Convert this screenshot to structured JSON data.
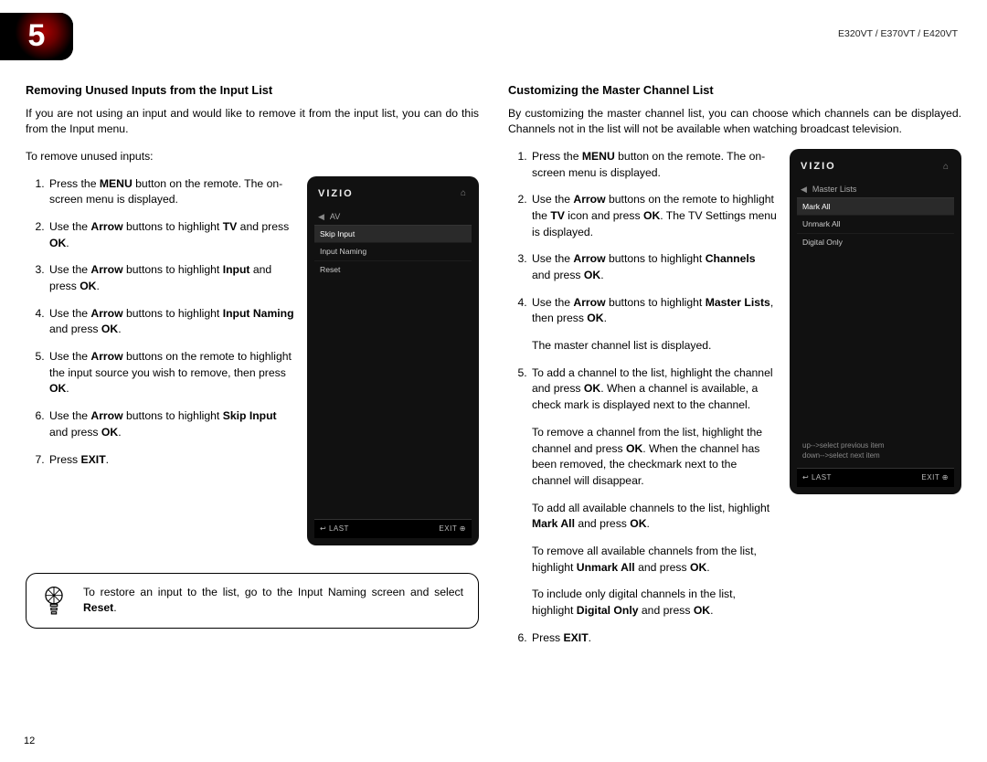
{
  "chapter_number": "5",
  "model_string": "E320VT / E370VT / E420VT",
  "page_number": "12",
  "left": {
    "heading": "Removing Unused Inputs from the Input List",
    "intro": "If you are not using an input and would like to remove it from the input list, you can do this from the Input menu.",
    "lead": "To remove unused inputs:",
    "steps": [
      {
        "parts": [
          "Press the ",
          "MENU",
          " button on the remote. The on-screen menu is displayed."
        ]
      },
      {
        "parts": [
          "Use the ",
          "Arrow",
          " buttons to highlight ",
          "TV",
          " and press ",
          "OK",
          "."
        ]
      },
      {
        "parts": [
          "Use the ",
          "Arrow",
          " buttons to highlight ",
          "Input",
          " and press ",
          "OK",
          "."
        ]
      },
      {
        "parts": [
          "Use the ",
          "Arrow",
          " buttons to highlight ",
          "Input Naming",
          " and press ",
          "OK",
          "."
        ]
      },
      {
        "parts": [
          "Use the ",
          "Arrow",
          " buttons on the remote to highlight the input source you wish to remove, then press ",
          "OK",
          "."
        ]
      },
      {
        "parts": [
          "Use the ",
          "Arrow",
          " buttons to highlight ",
          "Skip Input",
          " and press ",
          "OK",
          "."
        ]
      },
      {
        "parts": [
          "Press ",
          "EXIT",
          "."
        ]
      }
    ],
    "phone": {
      "brand": "VIZIO",
      "crumb": "AV",
      "rows": [
        "Skip Input",
        "Input Naming",
        "Reset"
      ],
      "last": "LAST",
      "exit": "EXIT"
    },
    "tip_pre": "To restore an input to the list, go to the Input Naming screen and select ",
    "tip_bold": "Reset",
    "tip_post": "."
  },
  "right": {
    "heading": "Customizing the Master Channel List",
    "intro": "By customizing the master channel list, you can choose which channels can be displayed. Channels not in the list will not be available when watching broadcast television.",
    "steps": [
      {
        "parts": [
          "Press the ",
          "MENU",
          " button on the remote. The on-screen menu is displayed."
        ]
      },
      {
        "parts": [
          "Use the ",
          "Arrow",
          " buttons on the remote to highlight the ",
          "TV",
          " icon and press ",
          "OK",
          ". The TV Settings menu is displayed."
        ]
      },
      {
        "parts": [
          "Use the ",
          "Arrow",
          " buttons to highlight ",
          "Channels",
          " and press ",
          "OK",
          "."
        ]
      },
      {
        "parts": [
          "Use the ",
          "Arrow",
          " buttons to highlight ",
          "Master Lists",
          ", then press ",
          "OK",
          "."
        ],
        "extra": "The master channel list is displayed."
      },
      {
        "parts": [
          "To add a channel to the list, highlight the channel and press ",
          "OK",
          ". When a channel is available, a check mark is displayed next to the channel."
        ],
        "extra_rich": [
          {
            "plain": [
              "To remove a channel from the list, highlight the channel and press ",
              "OK",
              ". When the channel has been removed, the checkmark next to the channel will disappear."
            ]
          },
          {
            "plain": [
              "To add all available channels to the list, highlight ",
              "Mark All",
              " and press ",
              "OK",
              "."
            ]
          },
          {
            "plain": [
              "To remove all available channels from the list, highlight ",
              "Unmark All",
              " and press ",
              "OK",
              "."
            ]
          },
          {
            "plain": [
              "To include only digital channels in the list, highlight ",
              "Digital Only",
              " and press ",
              "OK",
              "."
            ]
          }
        ]
      },
      {
        "parts": [
          "Press ",
          "EXIT",
          "."
        ]
      }
    ],
    "phone": {
      "brand": "VIZIO",
      "crumb": "Master Lists",
      "rows": [
        "Mark All",
        "Unmark All",
        "Digital Only"
      ],
      "hints_up": "up-->select previous item",
      "hints_down": "down-->select next item",
      "last": "LAST",
      "exit": "EXIT"
    }
  }
}
